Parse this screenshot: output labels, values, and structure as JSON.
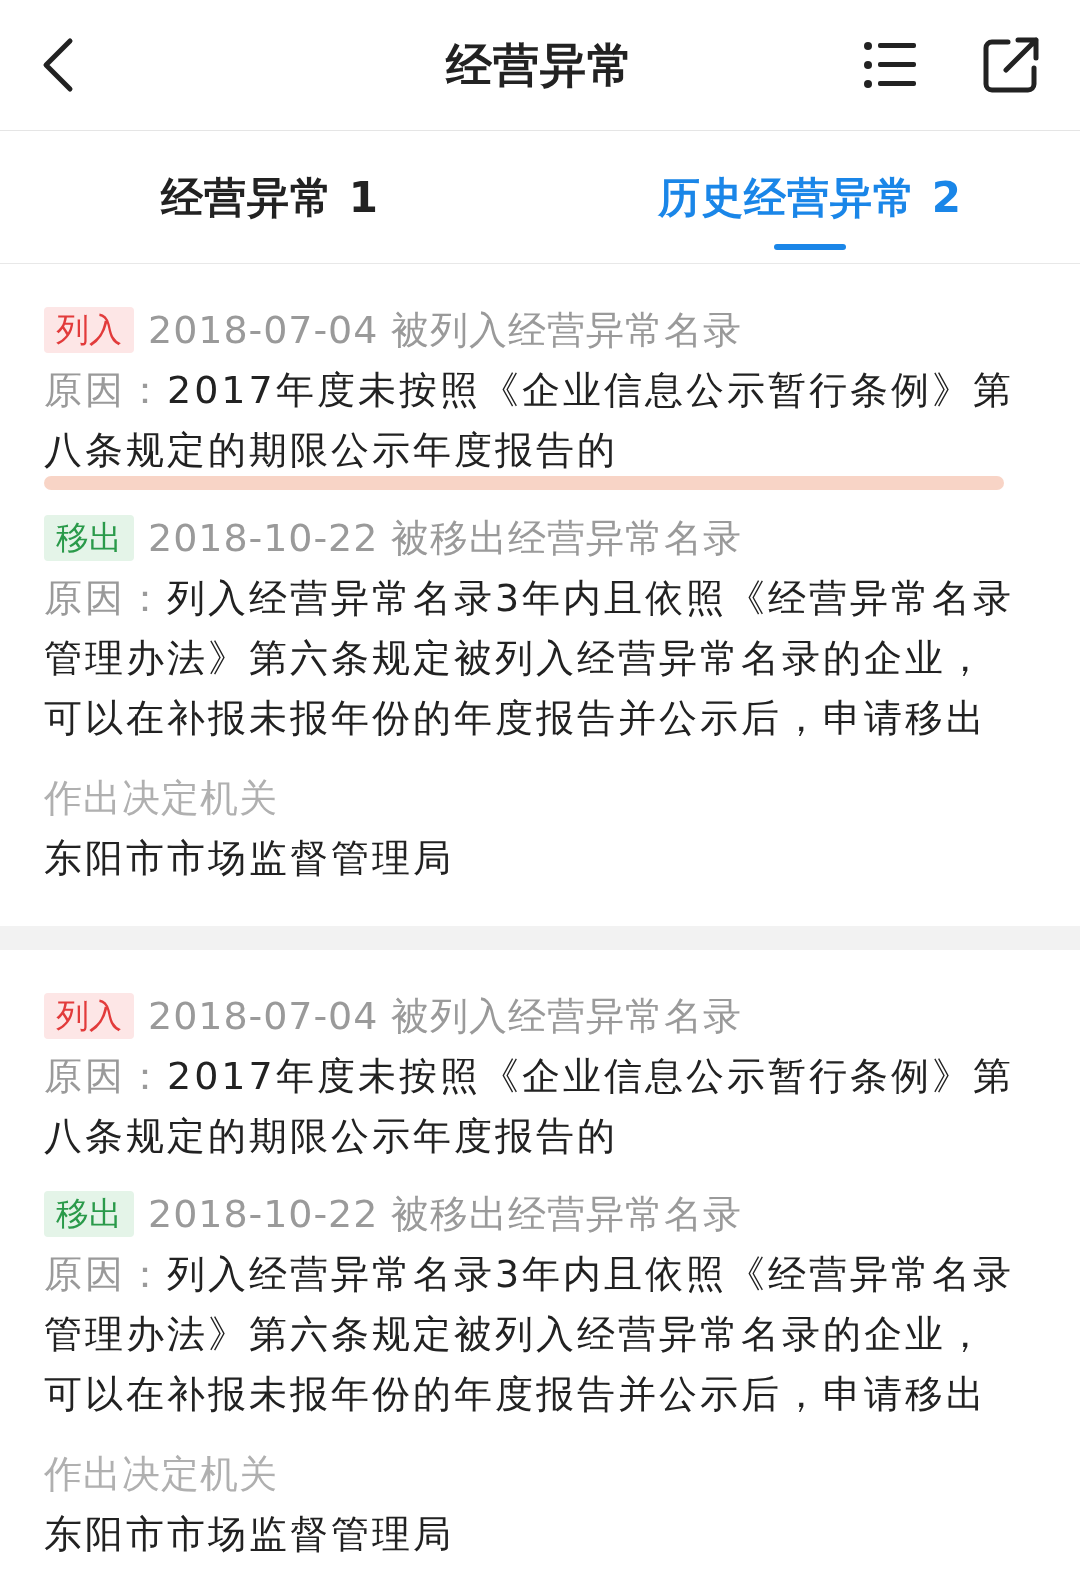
{
  "header": {
    "title": "经营异常"
  },
  "tabs": [
    {
      "label": "经营异常 1",
      "selected": false
    },
    {
      "label": "历史经营异常 2",
      "selected": true
    }
  ],
  "records": [
    {
      "events": [
        {
          "kind": "listed",
          "tag": "列入",
          "date_text": "2018-07-04 被列入经营异常名录",
          "reason_label": "原因：",
          "reason": "2017年度未按照《企业信息公示暂行条例》第八条规定的期限公示年度报告的",
          "highlighted": true
        },
        {
          "kind": "removed",
          "tag": "移出",
          "date_text": "2018-10-22 被移出经营异常名录",
          "reason_label": "原因：",
          "reason": "列入经营异常名录3年内且依照《经营异常名录管理办法》第六条规定被列入经营异常名录的企业，可以在补报未报年份的年度报告并公示后，申请移出",
          "highlighted": false
        }
      ],
      "authority_label": "作出决定机关",
      "authority": "东阳市市场监督管理局"
    },
    {
      "events": [
        {
          "kind": "listed",
          "tag": "列入",
          "date_text": "2018-07-04 被列入经营异常名录",
          "reason_label": "原因：",
          "reason": "2017年度未按照《企业信息公示暂行条例》第八条规定的期限公示年度报告的",
          "highlighted": false
        },
        {
          "kind": "removed",
          "tag": "移出",
          "date_text": "2018-10-22 被移出经营异常名录",
          "reason_label": "原因：",
          "reason": "列入经营异常名录3年内且依照《经营异常名录管理办法》第六条规定被列入经营异常名录的企业，可以在补报未报年份的年度报告并公示后，申请移出",
          "highlighted": false
        }
      ],
      "authority_label": "作出决定机关",
      "authority": "东阳市市场监督管理局"
    }
  ]
}
